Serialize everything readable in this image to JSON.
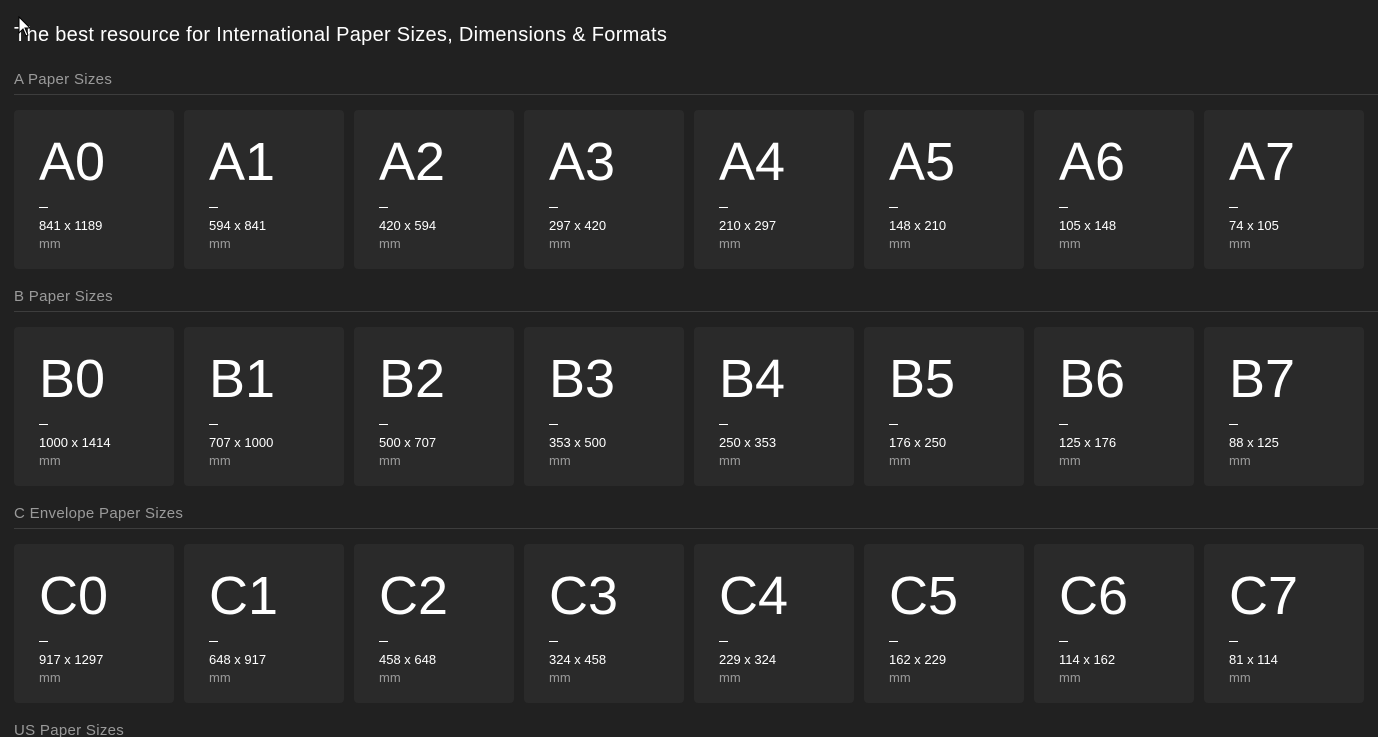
{
  "page": {
    "title": "The best resource for International Paper Sizes, Dimensions & Formats"
  },
  "sections": [
    {
      "heading": "A Paper Sizes",
      "cards": [
        {
          "name": "A0",
          "dims": "841 x 1189",
          "unit": "mm"
        },
        {
          "name": "A1",
          "dims": "594 x 841",
          "unit": "mm"
        },
        {
          "name": "A2",
          "dims": "420 x 594",
          "unit": "mm"
        },
        {
          "name": "A3",
          "dims": "297 x 420",
          "unit": "mm"
        },
        {
          "name": "A4",
          "dims": "210 x 297",
          "unit": "mm"
        },
        {
          "name": "A5",
          "dims": "148 x 210",
          "unit": "mm"
        },
        {
          "name": "A6",
          "dims": "105 x 148",
          "unit": "mm"
        },
        {
          "name": "A7",
          "dims": "74 x 105",
          "unit": "mm"
        }
      ]
    },
    {
      "heading": "B Paper Sizes",
      "cards": [
        {
          "name": "B0",
          "dims": "1000 x 1414",
          "unit": "mm"
        },
        {
          "name": "B1",
          "dims": "707 x 1000",
          "unit": "mm"
        },
        {
          "name": "B2",
          "dims": "500 x 707",
          "unit": "mm"
        },
        {
          "name": "B3",
          "dims": "353 x 500",
          "unit": "mm"
        },
        {
          "name": "B4",
          "dims": "250 x 353",
          "unit": "mm"
        },
        {
          "name": "B5",
          "dims": "176 x 250",
          "unit": "mm"
        },
        {
          "name": "B6",
          "dims": "125 x 176",
          "unit": "mm"
        },
        {
          "name": "B7",
          "dims": "88 x 125",
          "unit": "mm"
        }
      ]
    },
    {
      "heading": "C Envelope Paper Sizes",
      "cards": [
        {
          "name": "C0",
          "dims": "917 x 1297",
          "unit": "mm"
        },
        {
          "name": "C1",
          "dims": "648 x 917",
          "unit": "mm"
        },
        {
          "name": "C2",
          "dims": "458 x 648",
          "unit": "mm"
        },
        {
          "name": "C3",
          "dims": "324 x 458",
          "unit": "mm"
        },
        {
          "name": "C4",
          "dims": "229 x 324",
          "unit": "mm"
        },
        {
          "name": "C5",
          "dims": "162 x 229",
          "unit": "mm"
        },
        {
          "name": "C6",
          "dims": "114 x 162",
          "unit": "mm"
        },
        {
          "name": "C7",
          "dims": "81 x 114",
          "unit": "mm"
        }
      ]
    },
    {
      "heading": "US Paper Sizes",
      "cards": []
    }
  ],
  "colors": {
    "background": "#212121",
    "card": "#2a2a2a",
    "muted_text": "#9a9a9a",
    "text": "#ffffff",
    "rule": "#3d3d3d"
  },
  "icons": {
    "cursor": "mouse-pointer-icon"
  }
}
